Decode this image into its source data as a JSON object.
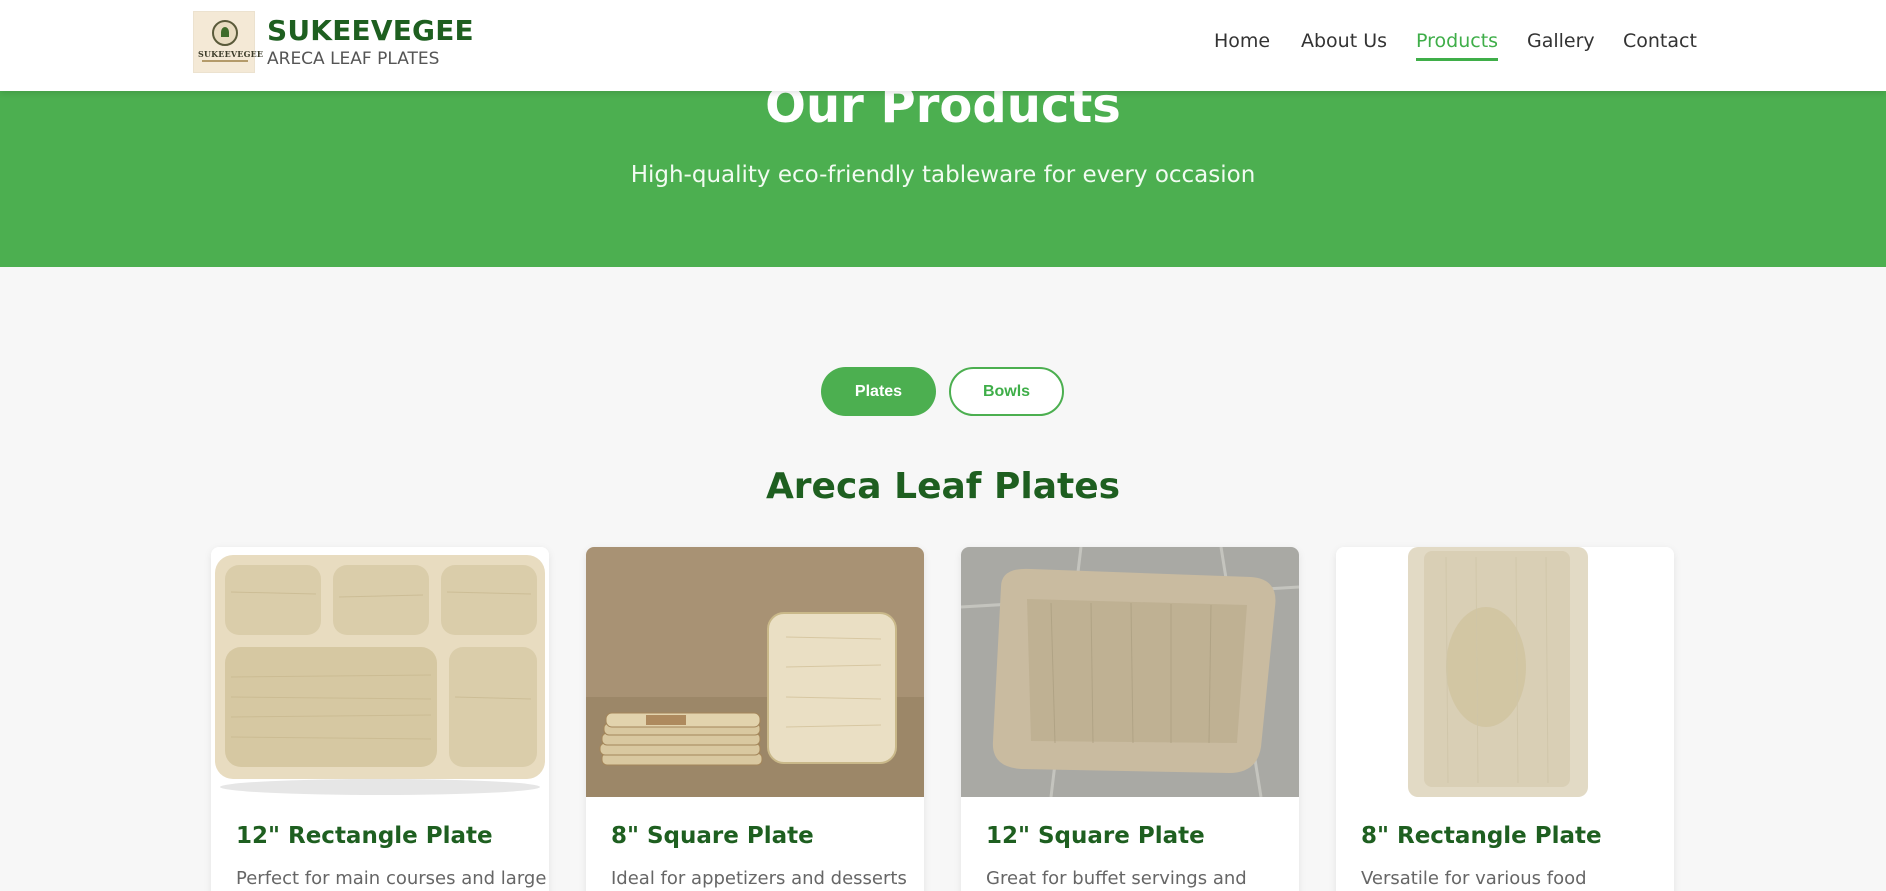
{
  "brand": {
    "name": "SUKEEVEGEE",
    "subtitle": "ARECA LEAF PLATES",
    "logo_text": "SUKEEVEGEE"
  },
  "nav": {
    "items": [
      {
        "label": "Home"
      },
      {
        "label": "About Us"
      },
      {
        "label": "Products",
        "active": true
      },
      {
        "label": "Gallery"
      },
      {
        "label": "Contact"
      }
    ]
  },
  "hero": {
    "title": "Our Products",
    "subtitle": "High-quality eco-friendly tableware for every occasion"
  },
  "tabs": {
    "plates": "Plates",
    "bowls": "Bowls",
    "selected": "Plates"
  },
  "section": {
    "title": "Areca Leaf Plates"
  },
  "products": [
    {
      "title": "12\" Rectangle Plate",
      "desc": "Perfect for main courses and large"
    },
    {
      "title": "8\" Square Plate",
      "desc": "Ideal for appetizers and desserts"
    },
    {
      "title": "12\" Square Plate",
      "desc": "Great for buffet servings and"
    },
    {
      "title": "8\" Rectangle Plate",
      "desc": "Versatile for various food"
    }
  ],
  "colors": {
    "brand_green": "#1e5f20",
    "accent_green": "#4caf50",
    "nav_active": "#3fae49"
  }
}
